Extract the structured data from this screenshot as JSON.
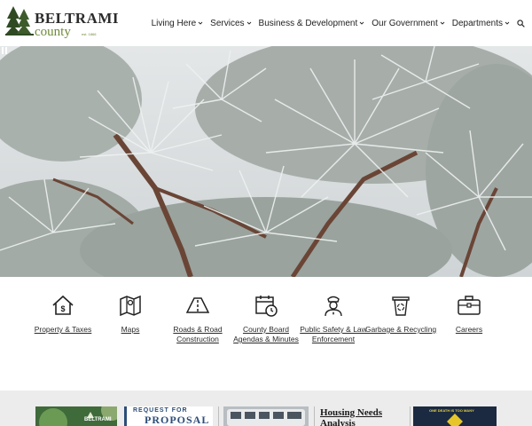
{
  "brand": {
    "name_main": "BELTRAMI",
    "name_sub": "county",
    "est": "est. 1866"
  },
  "nav": {
    "items": [
      {
        "label": "Living Here"
      },
      {
        "label": "Services"
      },
      {
        "label": "Business & Development"
      },
      {
        "label": "Our Government"
      },
      {
        "label": "Departments"
      }
    ]
  },
  "quick_links": [
    {
      "label": "Property & Taxes",
      "icon": "house-dollar-icon"
    },
    {
      "label": "Maps",
      "icon": "map-pin-icon"
    },
    {
      "label": "Roads & Road Construction",
      "icon": "road-icon"
    },
    {
      "label": "County Board Agendas & Minutes",
      "icon": "calendar-clock-icon"
    },
    {
      "label": "Public Safety & Law Enforcement",
      "icon": "officer-icon"
    },
    {
      "label": "Garbage & Recycling",
      "icon": "recycle-bin-icon"
    },
    {
      "label": "Careers",
      "icon": "briefcase-icon"
    }
  ],
  "cards": {
    "card1_text": "BELTRAMI",
    "rfp_line1": "REQUEST FOR",
    "rfp_line2": "PROPOSAL",
    "housing_line1": "Housing Needs",
    "housing_line2": "Analysis",
    "card5_text": "ONE DEATH IS TOO MANY"
  },
  "colors": {
    "brand_green": "#6f8a3a",
    "band_gray": "#ececec",
    "rfp_blue": "#2d4d78"
  }
}
